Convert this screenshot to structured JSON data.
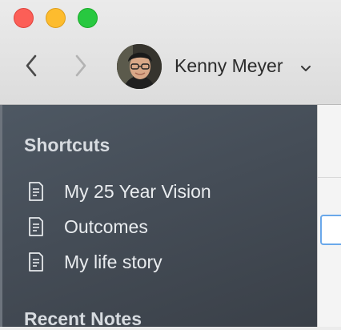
{
  "titlebar": {
    "user": {
      "name": "Kenny Meyer"
    }
  },
  "sidebar": {
    "shortcuts_title": "Shortcuts",
    "shortcuts": [
      {
        "label": "My 25 Year Vision",
        "icon": "document-icon"
      },
      {
        "label": "Outcomes",
        "icon": "document-icon"
      },
      {
        "label": "My life story",
        "icon": "document-icon"
      }
    ],
    "recent_title": "Recent Notes"
  },
  "colors": {
    "close": "#fc5f57",
    "minimize": "#fdbc2e",
    "maximize": "#28c840",
    "sidebar_bg": "#4a535d",
    "focus_ring": "#6aa8ea"
  }
}
